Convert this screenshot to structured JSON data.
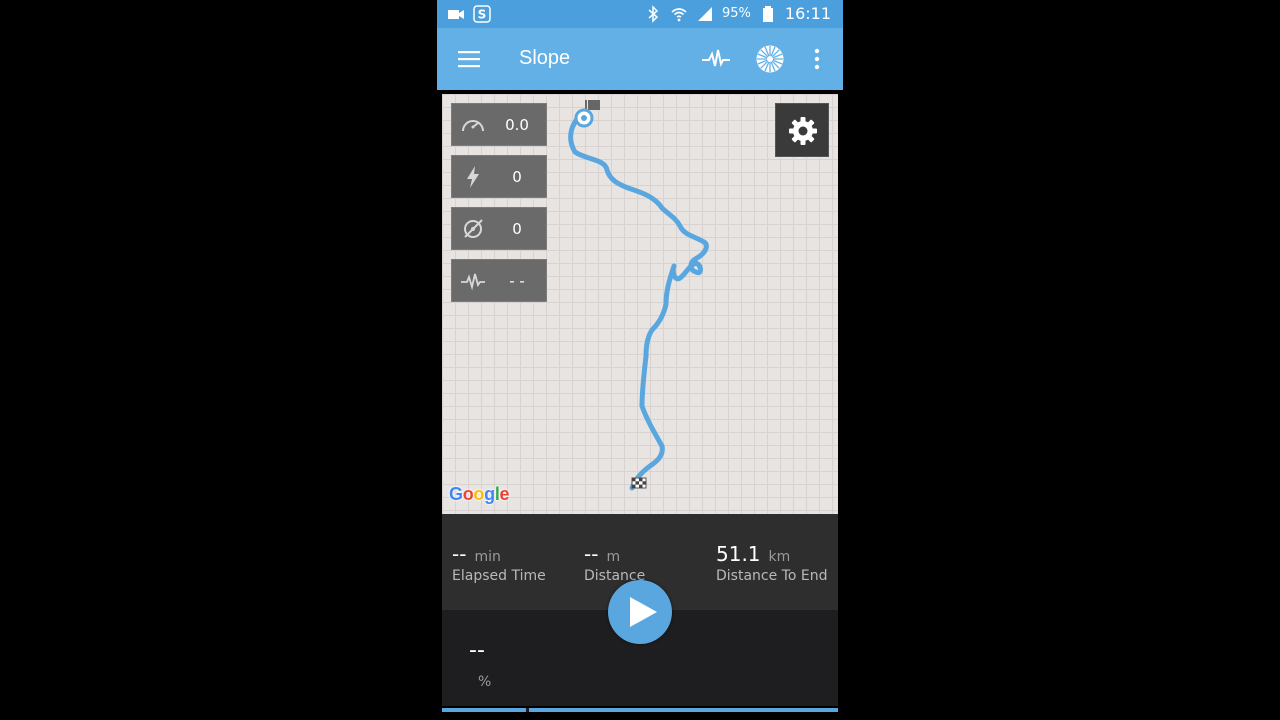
{
  "status_bar": {
    "battery": "95%",
    "time": "16:11",
    "icons": [
      "video-icon",
      "skype-icon",
      "bluetooth-icon",
      "wifi-icon",
      "signal-icon",
      "battery-icon"
    ]
  },
  "app_bar": {
    "title": "Slope",
    "icons": [
      "menu-icon",
      "pulse-icon",
      "wheel-icon",
      "more-vert-icon"
    ]
  },
  "map": {
    "provider_logo": "Google",
    "metrics": [
      {
        "icon": "speedometer-icon",
        "value": "0.0"
      },
      {
        "icon": "lightning-icon",
        "value": "0"
      },
      {
        "icon": "cadence-icon",
        "value": "0"
      },
      {
        "icon": "heart-rate-icon",
        "value": "- -"
      }
    ],
    "settings_icon": "gear-icon"
  },
  "stats": {
    "elapsed": {
      "value": "--",
      "unit": "min",
      "label": "Elapsed Time"
    },
    "distance": {
      "value": "--",
      "unit": "m",
      "label": "Distance"
    },
    "to_end": {
      "value": "51.1",
      "unit": "km",
      "label": "Distance To End"
    }
  },
  "slope": {
    "value": "--",
    "unit": "%"
  },
  "colors": {
    "accent": "#5aa7e0",
    "appbar": "#62b0e6",
    "statusbar": "#4a9fdc",
    "route": "#5aa7e0"
  }
}
